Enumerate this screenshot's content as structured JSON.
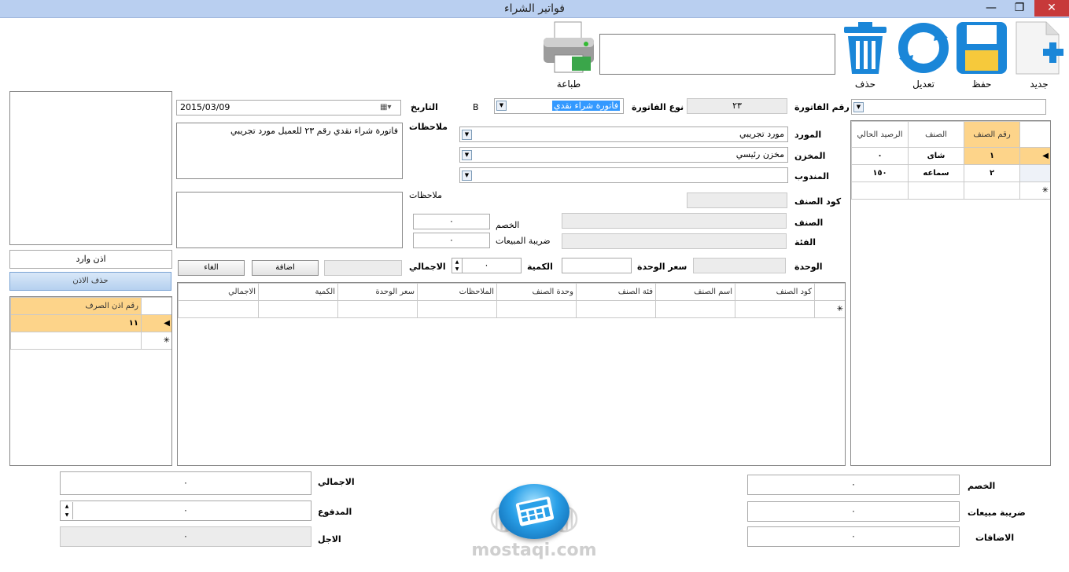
{
  "window": {
    "title": "فواتير الشراء",
    "close": "✕",
    "restore": "❐",
    "minimize": "—"
  },
  "toolbar": {
    "new": "جديد",
    "save": "حفظ",
    "edit": "تعديل",
    "delete": "حذف",
    "print": "طباعة"
  },
  "header": {
    "invoice_no_label": "رقم الفاتورة",
    "invoice_no_value": "٢٣",
    "invoice_type_label": "نوع الفاتورة",
    "invoice_type_value": "فاتورة شراء نقدي",
    "b_marker": "B",
    "date_label": "التاريخ",
    "date_value": "2015/03/09",
    "notes_label": "ملاحظات",
    "notes_value": "فاتورة شراء نقدي رقم  ٢٣  للعميل  مورد تجريبي",
    "notes2_label": "ملاحظات"
  },
  "form": {
    "supplier_label": "المورد",
    "supplier_value": "مورد تجريبي",
    "store_label": "المخزن",
    "store_value": "مخزن رئيسي",
    "rep_label": "المندوب",
    "rep_value": "",
    "item_code_label": "كود الصنف",
    "item_label": "الصنف",
    "category_label": "الفئة",
    "unit_label": "الوحدة",
    "unit_price_label": "سعر الوحدة",
    "qty_label": "الكمية",
    "qty_value": "٠",
    "total_label": "الاجمالي",
    "discount_label": "الخصم",
    "discount_value": "٠",
    "sales_tax_label": "ضريبة المبيعات",
    "sales_tax_value": "٠",
    "add_button": "اضافة",
    "cancel_button": "الغاء"
  },
  "items_grid": {
    "headers": [
      "رقم الصنف",
      "الصنف",
      "الرصيد الحالي"
    ],
    "rows": [
      {
        "no": "١",
        "name": "شاى",
        "balance": "٠"
      },
      {
        "no": "٢",
        "name": "سماعه",
        "balance": "١٥٠"
      }
    ]
  },
  "lines_grid": {
    "headers": [
      "كود الصنف",
      "اسم الصنف",
      "فئة الصنف",
      "وحدة الصنف",
      "الملاحظات",
      "سعر الوحدة",
      "الكمية",
      "الاجمالي"
    ]
  },
  "left_panel": {
    "receipt_label": "اذن وارد",
    "delete_permit_button": "حذف الاذن",
    "permit_grid_header": "رقم اذن الصرف",
    "permit_rows": [
      "١١"
    ]
  },
  "totals": {
    "discount_label": "الخصم",
    "discount_value": "٠",
    "sales_tax_label": "ضريبة مبيعات",
    "sales_tax_value": "٠",
    "additions_label": "الاضافات",
    "additions_value": "٠",
    "total_label": "الاجمالي",
    "total_value": "٠",
    "paid_label": "المدفوع",
    "paid_value": "٠",
    "remaining_label": "الاجل",
    "remaining_value": "٠"
  },
  "watermark": {
    "text": "mostaqi.com"
  },
  "colors": {
    "titlebar": "#b9cff0",
    "selected_row": "#fdd48a",
    "accent_blue": "#1a86d8"
  }
}
